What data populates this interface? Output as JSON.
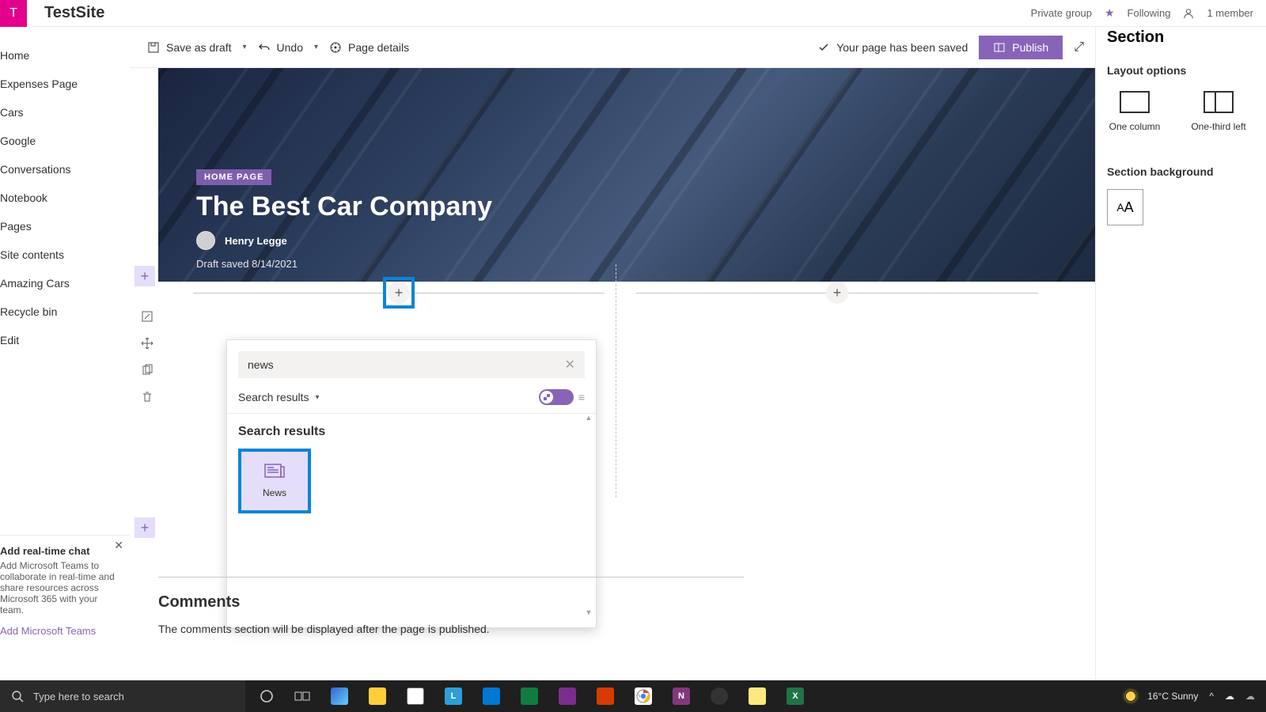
{
  "site": {
    "logo_letter": "T",
    "name": "TestSite",
    "privacy": "Private group",
    "following": "Following",
    "members": "1 member"
  },
  "leftnav": [
    "Home",
    "Expenses Page",
    "Cars",
    "Google",
    "Conversations",
    "Notebook",
    "Pages",
    "Site contents",
    "Amazing Cars",
    "Recycle bin",
    "Edit"
  ],
  "promo": {
    "title": "Add real-time chat",
    "body": "Add Microsoft Teams to collaborate in real-time and share resources across Microsoft 365 with your team.",
    "link": "Add Microsoft Teams"
  },
  "cmdbar": {
    "save_draft": "Save as draft",
    "undo": "Undo",
    "page_details": "Page details",
    "saved_msg": "Your page has been saved",
    "publish": "Publish"
  },
  "hero": {
    "badge": "HOME PAGE",
    "title": "The Best Car Company",
    "author": "Henry Legge",
    "draft": "Draft saved 8/14/2021"
  },
  "picker": {
    "search_value": "news",
    "filter_label": "Search results",
    "heading": "Search results",
    "result_label": "News"
  },
  "comments": {
    "heading": "Comments",
    "note": "The comments section will be displayed after the page is published."
  },
  "rpanel": {
    "title": "Section",
    "layout_header": "Layout options",
    "one_col": "One column",
    "one_third": "One-third left",
    "bg_header": "Section background"
  },
  "taskbar": {
    "search_placeholder": "Type here to search",
    "weather": "16°C  Sunny"
  }
}
